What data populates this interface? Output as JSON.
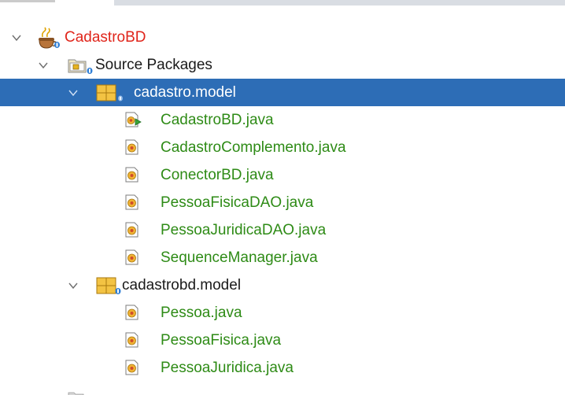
{
  "tree": {
    "project": {
      "label": "CadastroBD",
      "icon": "java-project-icon",
      "expanded": true
    },
    "source_packages": {
      "label": "Source Packages",
      "icon": "source-packages-folder-icon",
      "expanded": true
    },
    "packages": [
      {
        "label": "cadastro.model",
        "icon": "package-icon",
        "expanded": true,
        "selected": true,
        "files": [
          {
            "label": "CadastroBD.java",
            "icon": "java-main-class-icon"
          },
          {
            "label": "CadastroComplemento.java",
            "icon": "java-class-icon"
          },
          {
            "label": "ConectorBD.java",
            "icon": "java-class-icon"
          },
          {
            "label": "PessoaFisicaDAO.java",
            "icon": "java-class-icon"
          },
          {
            "label": "PessoaJuridicaDAO.java",
            "icon": "java-class-icon"
          },
          {
            "label": "SequenceManager.java",
            "icon": "java-class-icon"
          }
        ]
      },
      {
        "label": "cadastrobd.model",
        "icon": "package-icon",
        "expanded": true,
        "selected": false,
        "files": [
          {
            "label": "Pessoa.java",
            "icon": "java-class-icon"
          },
          {
            "label": "PessoaFisica.java",
            "icon": "java-class-icon"
          },
          {
            "label": "PessoaJuridica.java",
            "icon": "java-class-icon"
          }
        ]
      }
    ]
  },
  "colors": {
    "selection": "#2d6db6",
    "project_text": "#e0251b",
    "file_text": "#2e8b16",
    "default_text": "#1a1a1a"
  }
}
